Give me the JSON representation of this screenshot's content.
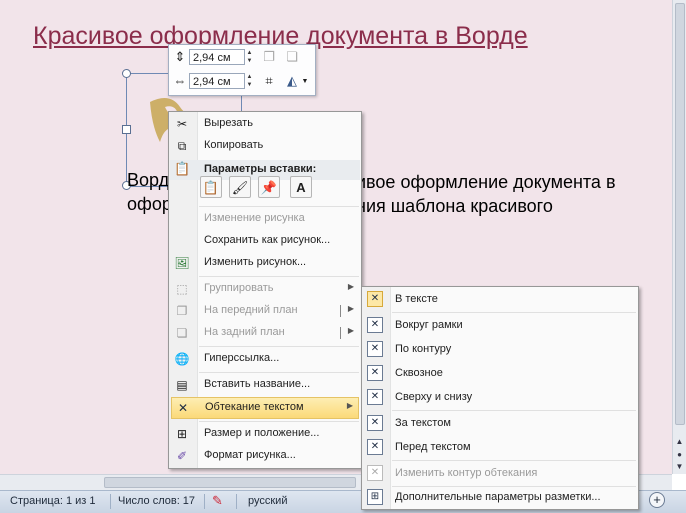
{
  "document": {
    "title": "Красивое оформление документа в Ворде",
    "paragraph_lines": [
      "Ворд",
      "офор"
    ],
    "paragraph_right_lines": [
      "ивое оформление документа в",
      "ния шаблона красивого"
    ]
  },
  "mini_toolbar": {
    "height_value": "2,94 см",
    "width_value": "2,94 см"
  },
  "context_menu": {
    "items": [
      {
        "label": "Вырезать",
        "icon": "scissors-icon"
      },
      {
        "label": "Копировать",
        "icon": "copy-icon"
      },
      {
        "label": "Параметры вставки:",
        "icon": "paste-icon"
      },
      {
        "label": "Изменение рисунка",
        "disabled": true
      },
      {
        "label": "Сохранить как рисунок..."
      },
      {
        "label": "Изменить рисунок...",
        "icon": "change-picture-icon"
      },
      {
        "label": "Группировать",
        "icon": "group-icon",
        "disabled": true
      },
      {
        "label": "На передний план",
        "icon": "bring-forward-icon",
        "disabled": true
      },
      {
        "label": "На задний план",
        "icon": "send-backward-icon",
        "disabled": true
      },
      {
        "label": "Гиперссылка...",
        "icon": "hyperlink-icon"
      },
      {
        "label": "Вставить название...",
        "icon": "caption-icon"
      },
      {
        "label": "Обтекание текстом",
        "icon": "text-wrap-icon"
      },
      {
        "label": "Размер и положение...",
        "icon": "size-position-icon"
      },
      {
        "label": "Формат рисунка...",
        "icon": "format-picture-icon"
      }
    ],
    "paste_options": [
      "keep-formatting",
      "merge-formatting",
      "picture",
      "text-only"
    ],
    "paste_text_glyph": "A"
  },
  "wrap_submenu": {
    "items": [
      {
        "label": "В тексте",
        "checked": true
      },
      {
        "label": "Вокруг рамки"
      },
      {
        "label": "По контуру"
      },
      {
        "label": "Сквозное"
      },
      {
        "label": "Сверху и снизу"
      },
      {
        "label": "За текстом"
      },
      {
        "label": "Перед текстом"
      },
      {
        "label": "Изменить контур обтекания",
        "disabled": true
      },
      {
        "label": "Дополнительные параметры разметки..."
      }
    ]
  },
  "status_bar": {
    "page": "Страница: 1 из 1",
    "words": "Число слов: 17",
    "language": "русский",
    "zoom_plus": "+"
  },
  "colors": {
    "document_bg": "#f2e4ea",
    "title": "#8b2d4b",
    "highlight": "#fbd979"
  }
}
